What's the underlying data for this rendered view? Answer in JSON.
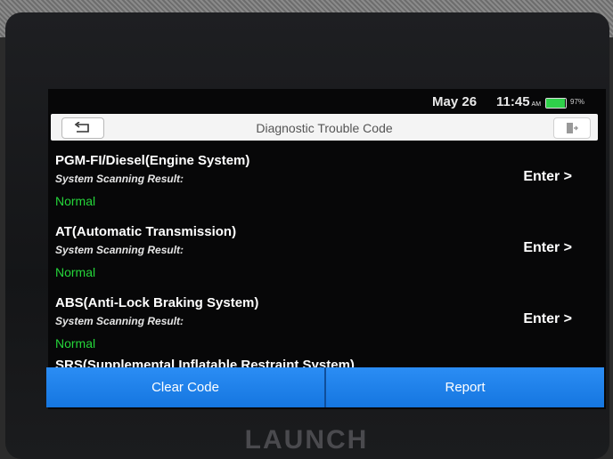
{
  "status": {
    "date": "May 26",
    "time": "11:45",
    "ampm": "AM",
    "battery_pct": "97%",
    "battery_level": 0.97
  },
  "header": {
    "title": "Diagnostic Trouble Code"
  },
  "systems": [
    {
      "name": "PGM-FI/Diesel(Engine System)",
      "label": "System Scanning Result:",
      "status": "Normal",
      "action": "Enter >"
    },
    {
      "name": "AT(Automatic Transmission)",
      "label": "System Scanning Result:",
      "status": "Normal",
      "action": "Enter >"
    },
    {
      "name": "ABS(Anti-Lock Braking System)",
      "label": "System Scanning Result:",
      "status": "Normal",
      "action": "Enter >"
    }
  ],
  "partial_item": {
    "name": "SRS(Supplemental Inflatable Restraint System)"
  },
  "footer": {
    "clear_label": "Clear Code",
    "report_label": "Report"
  },
  "brand": "LAUNCH",
  "colors": {
    "accent": "#1a7fe8",
    "status_ok": "#25d63a"
  }
}
